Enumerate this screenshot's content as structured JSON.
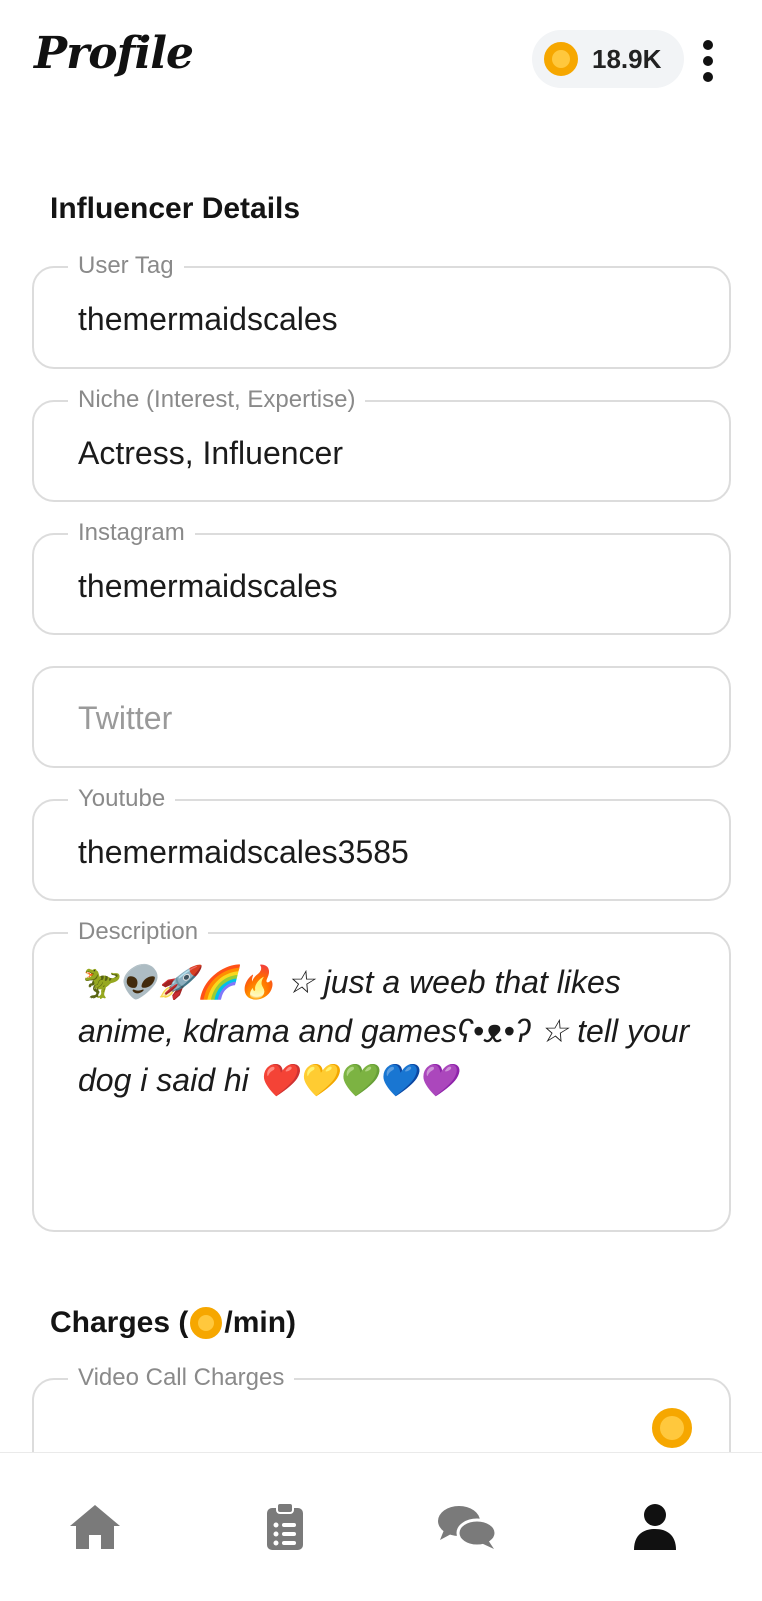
{
  "header": {
    "title": "Profile",
    "coin_balance": "18.9K",
    "icons": {
      "coin": "coin-icon",
      "menu": "more-vertical-icon"
    }
  },
  "influencer": {
    "section_title": "Influencer Details",
    "user_tag": {
      "label": "User Tag",
      "value": "themermaidscales"
    },
    "niche": {
      "label": "Niche (Interest, Expertise)",
      "value": "Actress, Influencer"
    },
    "instagram": {
      "label": "Instagram",
      "value": "themermaidscales"
    },
    "twitter": {
      "placeholder": "Twitter",
      "value": ""
    },
    "youtube": {
      "label": "Youtube",
      "value": "themermaidscales3585"
    },
    "description": {
      "label": "Description",
      "value": "🦖👽🚀🌈🔥 ☆ just a weeb that likes anime, kdrama and gamesʕ•ᴥ•ʔ ☆ tell your dog i said hi ❤️💛💚💙💜"
    }
  },
  "charges": {
    "title_prefix": "Charges (",
    "title_suffix": "/min)",
    "video_call": {
      "label": "Video Call Charges"
    }
  },
  "bottom_nav": {
    "items": [
      {
        "icon": "home-icon",
        "active": false
      },
      {
        "icon": "clipboard-list-icon",
        "active": false
      },
      {
        "icon": "chat-bubbles-icon",
        "active": false
      },
      {
        "icon": "user-icon",
        "active": true
      }
    ]
  },
  "colors": {
    "coin_outer": "#f6a700",
    "coin_inner": "#ffc83d",
    "border": "#dcdcdc",
    "label": "#8a8a8a",
    "nav_inactive": "#7a7a7a",
    "nav_active": "#111111"
  }
}
